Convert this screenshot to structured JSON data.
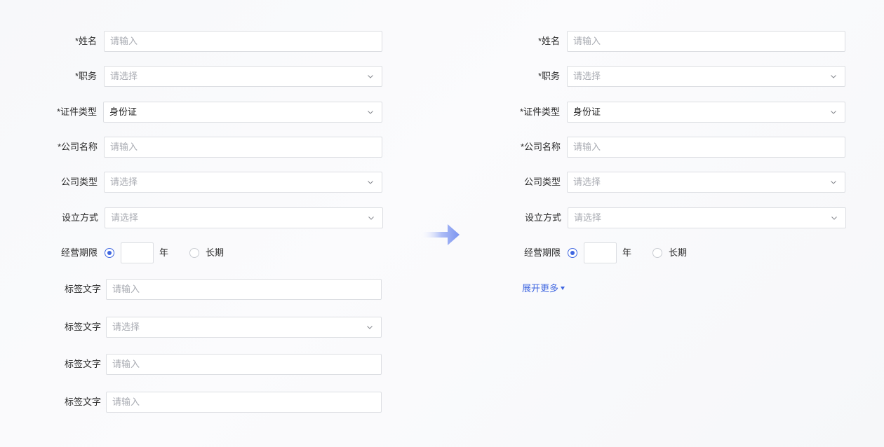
{
  "left_form": {
    "fields": [
      {
        "label": "*姓名",
        "kind": "input",
        "text": "请输入",
        "is_placeholder": true
      },
      {
        "label": "*职务",
        "kind": "select",
        "text": "请选择",
        "is_placeholder": true
      },
      {
        "label": "*证件类型",
        "kind": "select",
        "text": "身份证",
        "is_placeholder": false
      },
      {
        "label": "*公司名称",
        "kind": "input",
        "text": "请输入",
        "is_placeholder": true
      },
      {
        "label": "公司类型",
        "kind": "select",
        "text": "请选择",
        "is_placeholder": true
      },
      {
        "label": "设立方式",
        "kind": "select",
        "text": "请选择",
        "is_placeholder": true
      }
    ],
    "period": {
      "label": "经营期限",
      "unit": "年",
      "long_term": "长期",
      "selected": "years",
      "years_value": ""
    },
    "extra_fields": [
      {
        "label": "标签文字",
        "kind": "input",
        "text": "请输入",
        "is_placeholder": true
      },
      {
        "label": "标签文字",
        "kind": "select",
        "text": "请选择",
        "is_placeholder": true
      },
      {
        "label": "标签文字",
        "kind": "input",
        "text": "请输入",
        "is_placeholder": true
      },
      {
        "label": "标签文字",
        "kind": "input",
        "text": "请输入",
        "is_placeholder": true
      }
    ]
  },
  "right_form": {
    "fields": [
      {
        "label": "*姓名",
        "kind": "input",
        "text": "请输入",
        "is_placeholder": true
      },
      {
        "label": "*职务",
        "kind": "select",
        "text": "请选择",
        "is_placeholder": true
      },
      {
        "label": "*证件类型",
        "kind": "select",
        "text": "身份证",
        "is_placeholder": false
      },
      {
        "label": "*公司名称",
        "kind": "input",
        "text": "请输入",
        "is_placeholder": true
      },
      {
        "label": "公司类型",
        "kind": "select",
        "text": "请选择",
        "is_placeholder": true
      },
      {
        "label": "设立方式",
        "kind": "select",
        "text": "请选择",
        "is_placeholder": true
      }
    ],
    "period": {
      "label": "经营期限",
      "unit": "年",
      "long_term": "长期",
      "selected": "years",
      "years_value": ""
    },
    "expand_label": "展开更多"
  },
  "colors": {
    "accent": "#3f66e0",
    "arrow_start": "#e8ecfb",
    "arrow_end": "#7a94f0",
    "border": "#dcdee2",
    "placeholder": "#a8abb2"
  },
  "icons": {
    "select_indicator": "chevron-down-icon",
    "transition_arrow": "arrow-right-icon",
    "expand_indicator": "caret-down-icon"
  }
}
